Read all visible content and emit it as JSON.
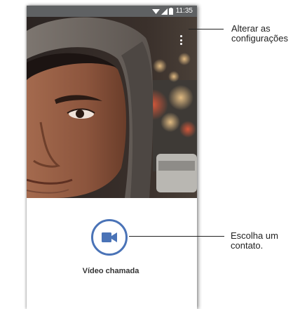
{
  "status_bar": {
    "time": "11:35",
    "icons": [
      "wifi-icon",
      "signal-icon",
      "battery-icon"
    ]
  },
  "preview": {
    "menu_icon": "overflow-menu-icon"
  },
  "call": {
    "video_call_label": "Vídeo chamada",
    "icon": "video-camera-icon",
    "accent": "#4a73b7"
  },
  "callouts": {
    "settings_line1": "Alterar as",
    "settings_line2": "configurações",
    "contact_line1": "Escolha um",
    "contact_line2": "contato."
  }
}
